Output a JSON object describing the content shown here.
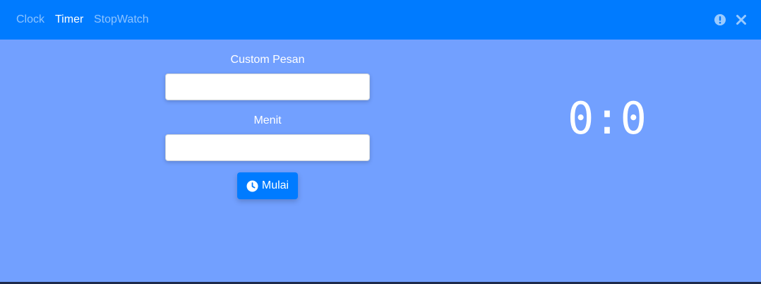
{
  "nav": {
    "items": [
      {
        "label": "Clock",
        "active": false
      },
      {
        "label": "Timer",
        "active": true
      },
      {
        "label": "StopWatch",
        "active": false
      }
    ],
    "icons": [
      "info-icon",
      "close-icon"
    ]
  },
  "form": {
    "message_label": "Custom Pesan",
    "message_value": "",
    "minutes_label": "Menit",
    "minutes_value": "",
    "start_label": "Mulai",
    "start_icon": "clock-icon"
  },
  "timer": {
    "display": "0:0"
  },
  "colors": {
    "navbar": "#007bff",
    "background": "#72a0ff",
    "button": "#007bff",
    "text": "#ffffff"
  }
}
